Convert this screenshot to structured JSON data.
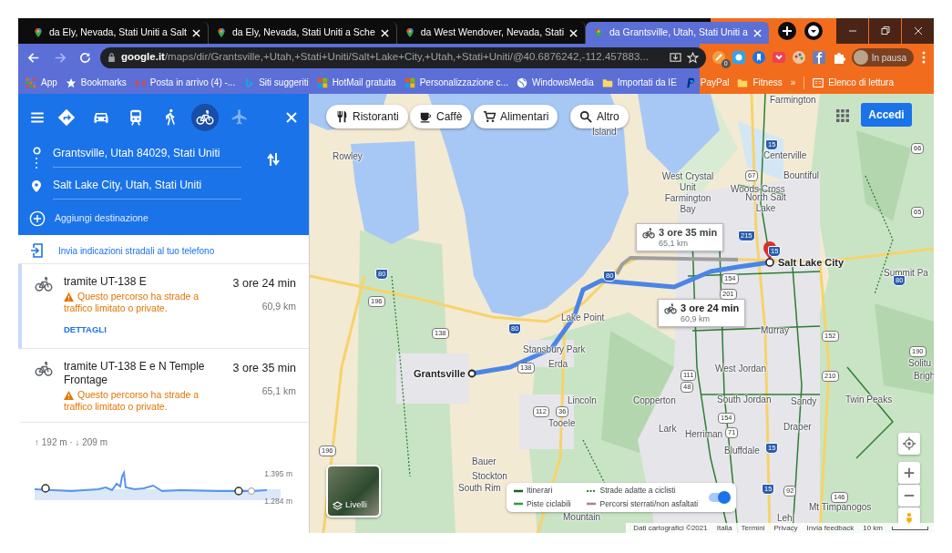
{
  "browser": {
    "tabs": [
      {
        "title": "da Ely, Nevada, Stati Uniti a Salt",
        "selected": false
      },
      {
        "title": "da Ely, Nevada, Stati Uniti a Sche",
        "selected": false
      },
      {
        "title": "da West Wendover, Nevada, Stati",
        "selected": false
      },
      {
        "title": "da Grantsville, Utah, Stati Uniti a",
        "selected": true
      }
    ],
    "address": {
      "domain": "google.it",
      "path": "/maps/dir/Grantsville,+Utah,+Stati+Uniti/Salt+Lake+City,+Utah,+Stati+Uniti/@40.6876242,-112.457883..."
    },
    "extension_badge": "0",
    "profile": "In pausa",
    "bookmarks": [
      {
        "kind": "apps",
        "label": "App"
      },
      {
        "kind": "star",
        "label": "Bookmarks"
      },
      {
        "kind": "mail",
        "label": "Posta in arrivo (4) -..."
      },
      {
        "kind": "bing",
        "label": "Siti suggeriti"
      },
      {
        "kind": "windows",
        "label": "HotMail gratuita"
      },
      {
        "kind": "windows",
        "label": "Personalizzazione c..."
      },
      {
        "kind": "globe",
        "label": "WindowsMedia"
      },
      {
        "kind": "folder",
        "label": "Importati da IE"
      },
      {
        "kind": "paypal",
        "label": "PayPal"
      },
      {
        "kind": "folder",
        "label": "Fitness"
      }
    ],
    "bookmarks_more": "»",
    "reading_list": "Elenco di lettura"
  },
  "directions": {
    "modes": [
      {
        "kind": "best",
        "selected": false,
        "disabled": false
      },
      {
        "kind": "car",
        "selected": false,
        "disabled": false
      },
      {
        "kind": "transit",
        "selected": false,
        "disabled": false
      },
      {
        "kind": "walk",
        "selected": false,
        "disabled": false
      },
      {
        "kind": "bike",
        "selected": true,
        "disabled": false
      },
      {
        "kind": "flight",
        "selected": false,
        "disabled": true
      }
    ],
    "origin": "Grantsville, Utah 84029, Stati Uniti",
    "destination": "Salt Lake City, Utah, Stati Uniti",
    "add_destination": "Aggiungi destinazione",
    "send_to_phone": "Invia indicazioni stradali al tuo telefono",
    "routes": [
      {
        "via": "tramite UT-138 E",
        "duration": "3 ore 24 min",
        "distance": "60,9 km",
        "warning": "Questo percorso ha strade a traffico limitato o private.",
        "details": "DETTAGLI",
        "selected": true
      },
      {
        "via": "tramite UT-138 E e N Temple Frontage",
        "duration": "3 ore 35 min",
        "distance": "65,1 km",
        "warning": "Questo percorso ha strade a traffico limitato o private.",
        "selected": false
      }
    ],
    "elevation": {
      "summary": "↑ 192 m · ↓ 209 m",
      "max": "1.395 m",
      "min": "1.284 m"
    }
  },
  "map": {
    "chips": [
      {
        "kind": "restaurant",
        "label": "Ristoranti"
      },
      {
        "kind": "cafe",
        "label": "Caffè"
      },
      {
        "kind": "grocery",
        "label": "Alimentari"
      },
      {
        "kind": "search",
        "label": "Altro"
      }
    ],
    "sign_in": "Accedi",
    "route_callouts": [
      {
        "duration": "3 ore 35 min",
        "distance": "65,1 km",
        "selected": false
      },
      {
        "duration": "3 ore 24 min",
        "distance": "60,9 km",
        "selected": true
      }
    ],
    "places": [
      {
        "kind": "place",
        "name": "Island"
      },
      {
        "kind": "place",
        "name": "Rowley"
      },
      {
        "kind": "place",
        "name": "West Crystal Unit Farmington Bay"
      },
      {
        "kind": "place",
        "name": "Farmington"
      },
      {
        "kind": "place",
        "name": "Centerville"
      },
      {
        "kind": "place",
        "name": "Bountiful"
      },
      {
        "kind": "place",
        "name": "Woods Cross"
      },
      {
        "kind": "place",
        "name": "North Salt Lake"
      },
      {
        "kind": "endpoint",
        "name": "Salt Lake City"
      },
      {
        "kind": "place",
        "name": "Summit Pa"
      },
      {
        "kind": "place",
        "name": "Lake Point"
      },
      {
        "kind": "place",
        "name": "Stansbury Park"
      },
      {
        "kind": "place",
        "name": "Erda"
      },
      {
        "kind": "endpoint",
        "name": "Grantsville"
      },
      {
        "kind": "place",
        "name": "Murray"
      },
      {
        "kind": "place",
        "name": "West Jordan"
      },
      {
        "kind": "place",
        "name": "Lincoln"
      },
      {
        "kind": "place",
        "name": "Copperton"
      },
      {
        "kind": "place",
        "name": "South Jordan"
      },
      {
        "kind": "place",
        "name": "Sandy"
      },
      {
        "kind": "place",
        "name": "Twin Peaks"
      },
      {
        "kind": "place",
        "name": "Tooele"
      },
      {
        "kind": "place",
        "name": "Lark"
      },
      {
        "kind": "place",
        "name": "Herriman"
      },
      {
        "kind": "place",
        "name": "Draper"
      },
      {
        "kind": "place",
        "name": "Bluffdale"
      },
      {
        "kind": "place",
        "name": "Solitu"
      },
      {
        "kind": "place",
        "name": "Brigh"
      },
      {
        "kind": "place",
        "name": "Bauer"
      },
      {
        "kind": "place",
        "name": "Stockton"
      },
      {
        "kind": "place",
        "name": "South Rim"
      },
      {
        "kind": "place",
        "name": "Mt Timpanogos"
      },
      {
        "kind": "place",
        "name": "Lehi"
      },
      {
        "kind": "place",
        "name": "Mountain"
      }
    ],
    "shields": [
      {
        "kind": "interstate",
        "number": "15"
      },
      {
        "kind": "state",
        "number": "67"
      },
      {
        "kind": "state",
        "number": "66"
      },
      {
        "kind": "state",
        "number": "65"
      },
      {
        "kind": "interstate",
        "number": "215"
      },
      {
        "kind": "interstate",
        "number": "80"
      },
      {
        "kind": "interstate",
        "number": "15"
      },
      {
        "kind": "interstate",
        "number": "80"
      },
      {
        "kind": "state",
        "number": "154"
      },
      {
        "kind": "state",
        "number": "201"
      },
      {
        "kind": "interstate",
        "number": "80"
      },
      {
        "kind": "state",
        "number": "196"
      },
      {
        "kind": "interstate",
        "number": "80"
      },
      {
        "kind": "state",
        "number": "138"
      },
      {
        "kind": "state",
        "number": "152"
      },
      {
        "kind": "state",
        "number": "190"
      },
      {
        "kind": "state",
        "number": "138"
      },
      {
        "kind": "state",
        "number": "210"
      },
      {
        "kind": "state",
        "number": "111"
      },
      {
        "kind": "state",
        "number": "48"
      },
      {
        "kind": "state",
        "number": "112"
      },
      {
        "kind": "state",
        "number": "36"
      },
      {
        "kind": "state",
        "number": "154"
      },
      {
        "kind": "state",
        "number": "71"
      },
      {
        "kind": "interstate",
        "number": "15"
      },
      {
        "kind": "state",
        "number": "196"
      },
      {
        "kind": "interstate",
        "number": "15"
      },
      {
        "kind": "state",
        "number": "92"
      },
      {
        "kind": "state",
        "number": "146"
      }
    ],
    "layers": "Livelli",
    "legend": [
      {
        "kind": "route",
        "label": "Itinerari"
      },
      {
        "kind": "dotted",
        "label": "Strade adatte a ciclisti"
      },
      {
        "kind": "lane",
        "label": "Piste ciclabili"
      },
      {
        "kind": "unpaved",
        "label": "Percorsi sterrati/non asfaltati"
      }
    ],
    "legend_toggle": {
      "on": true
    },
    "footer": [
      "Dati cartografici ©2021",
      "Italia",
      "Termini",
      "Privacy",
      "Invia feedback"
    ],
    "scale": "10 km"
  }
}
